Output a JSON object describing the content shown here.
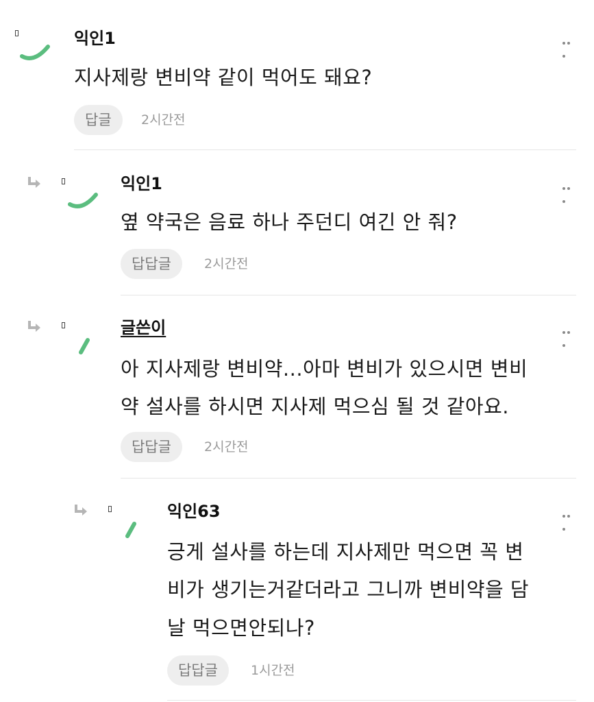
{
  "comments": [
    {
      "author": "익인1",
      "text_lines": [
        "지사제랑 변비약 같이 먹어도 돼요?"
      ],
      "reply_label": "답글",
      "time": "2시간전"
    },
    {
      "author": "익인1",
      "text_lines": [
        "옆 약국은 음료 하나 주던디 여긴 안 줘?"
      ],
      "reply_label": "답답글",
      "time": "2시간전"
    },
    {
      "author": "글쓴이",
      "text_lines": [
        "아 지사제랑 변비약...아마 변비가 있으시면 변비",
        "약 설사를 하시면 지사제 먹으심 될 것 같아요."
      ],
      "reply_label": "답답글",
      "time": "2시간전"
    },
    {
      "author": "익인63",
      "text_lines": [
        "긍게 설사를 하는데 지사제만 먹으면 꼭 변",
        "비가 생기는거같더라고 그니까 변비약을 담",
        "날 먹으면안되나?"
      ],
      "reply_label": "답답글",
      "time": "1시간전"
    }
  ],
  "icons": {
    "reply_arrow": "reply-arrow-icon",
    "more": "more-options-icon",
    "avatar": "avatar-mark"
  },
  "colors": {
    "accent_green": "#5bbd7f",
    "button_bg": "#eeeeee",
    "muted_text": "#9a9a9a"
  }
}
